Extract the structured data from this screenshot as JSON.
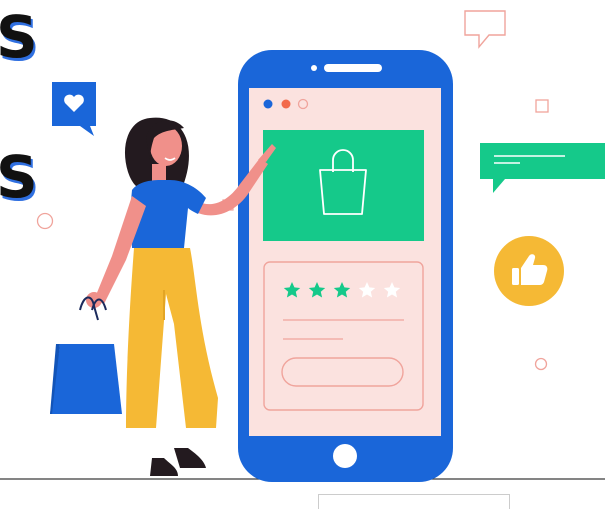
{
  "headline_fragments": [
    "S",
    "S"
  ],
  "colors": {
    "phone_frame": "#1a66d9",
    "screen_bg": "#fbe2df",
    "product_card": "#15c98a",
    "stars_filled": "#15c98a",
    "stars_empty": "#ffffff",
    "message_bubble": "#15c98a",
    "like_badge": "#f5b935",
    "heart_bubble": "#1a66d9",
    "shirt": "#1a66d9",
    "pants": "#f5b935",
    "shopping_bag": "#1a66d9",
    "skin": "#f0908a"
  },
  "rating": {
    "filled": 3,
    "total": 5
  },
  "icons": {
    "shopping_bag": "shopping-bag-icon",
    "heart": "heart-icon",
    "thumbs_up": "thumbs-up-icon",
    "chat": "chat-bubble-icon",
    "star": "star-icon"
  }
}
